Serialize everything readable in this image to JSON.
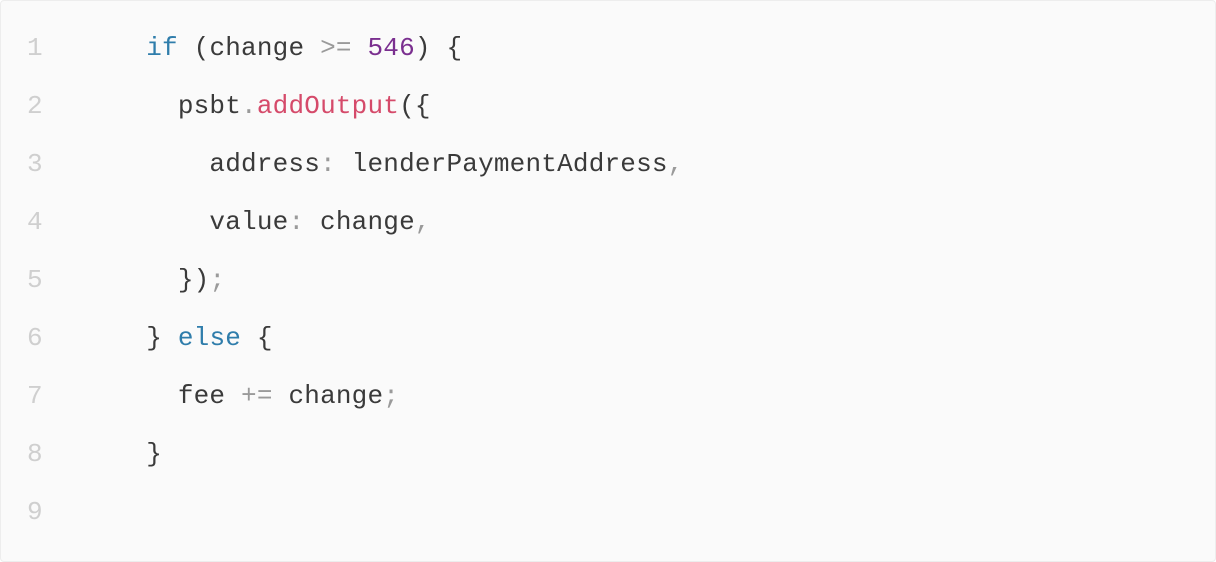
{
  "code": {
    "lines": [
      {
        "num": "1",
        "indent": "    ",
        "tokens": [
          {
            "cls": "tok-kw",
            "text": "if"
          },
          {
            "cls": "tok-id",
            "text": " "
          },
          {
            "cls": "tok-pn",
            "text": "("
          },
          {
            "cls": "tok-id",
            "text": "change "
          },
          {
            "cls": "tok-op",
            "text": ">="
          },
          {
            "cls": "tok-id",
            "text": " "
          },
          {
            "cls": "tok-num",
            "text": "546"
          },
          {
            "cls": "tok-pn",
            "text": ")"
          },
          {
            "cls": "tok-id",
            "text": " "
          },
          {
            "cls": "tok-pn",
            "text": "{"
          }
        ]
      },
      {
        "num": "2",
        "indent": "      ",
        "tokens": [
          {
            "cls": "tok-id",
            "text": "psbt"
          },
          {
            "cls": "tok-pc",
            "text": "."
          },
          {
            "cls": "tok-fn",
            "text": "addOutput"
          },
          {
            "cls": "tok-pn",
            "text": "({"
          }
        ]
      },
      {
        "num": "3",
        "indent": "        ",
        "tokens": [
          {
            "cls": "tok-key",
            "text": "address"
          },
          {
            "cls": "tok-pc",
            "text": ":"
          },
          {
            "cls": "tok-id",
            "text": " lenderPaymentAddress"
          },
          {
            "cls": "tok-pc",
            "text": ","
          }
        ]
      },
      {
        "num": "4",
        "indent": "        ",
        "tokens": [
          {
            "cls": "tok-key",
            "text": "value"
          },
          {
            "cls": "tok-pc",
            "text": ":"
          },
          {
            "cls": "tok-id",
            "text": " change"
          },
          {
            "cls": "tok-pc",
            "text": ","
          }
        ]
      },
      {
        "num": "5",
        "indent": "      ",
        "tokens": [
          {
            "cls": "tok-pn",
            "text": "})"
          },
          {
            "cls": "tok-pc",
            "text": ";"
          }
        ]
      },
      {
        "num": "6",
        "indent": "    ",
        "tokens": [
          {
            "cls": "tok-pn",
            "text": "}"
          },
          {
            "cls": "tok-id",
            "text": " "
          },
          {
            "cls": "tok-kw",
            "text": "else"
          },
          {
            "cls": "tok-id",
            "text": " "
          },
          {
            "cls": "tok-pn",
            "text": "{"
          }
        ]
      },
      {
        "num": "7",
        "indent": "      ",
        "tokens": [
          {
            "cls": "tok-id",
            "text": "fee "
          },
          {
            "cls": "tok-op",
            "text": "+="
          },
          {
            "cls": "tok-id",
            "text": " change"
          },
          {
            "cls": "tok-pc",
            "text": ";"
          }
        ]
      },
      {
        "num": "8",
        "indent": "    ",
        "tokens": [
          {
            "cls": "tok-pn",
            "text": "}"
          }
        ]
      },
      {
        "num": "9",
        "indent": "",
        "tokens": []
      }
    ]
  }
}
